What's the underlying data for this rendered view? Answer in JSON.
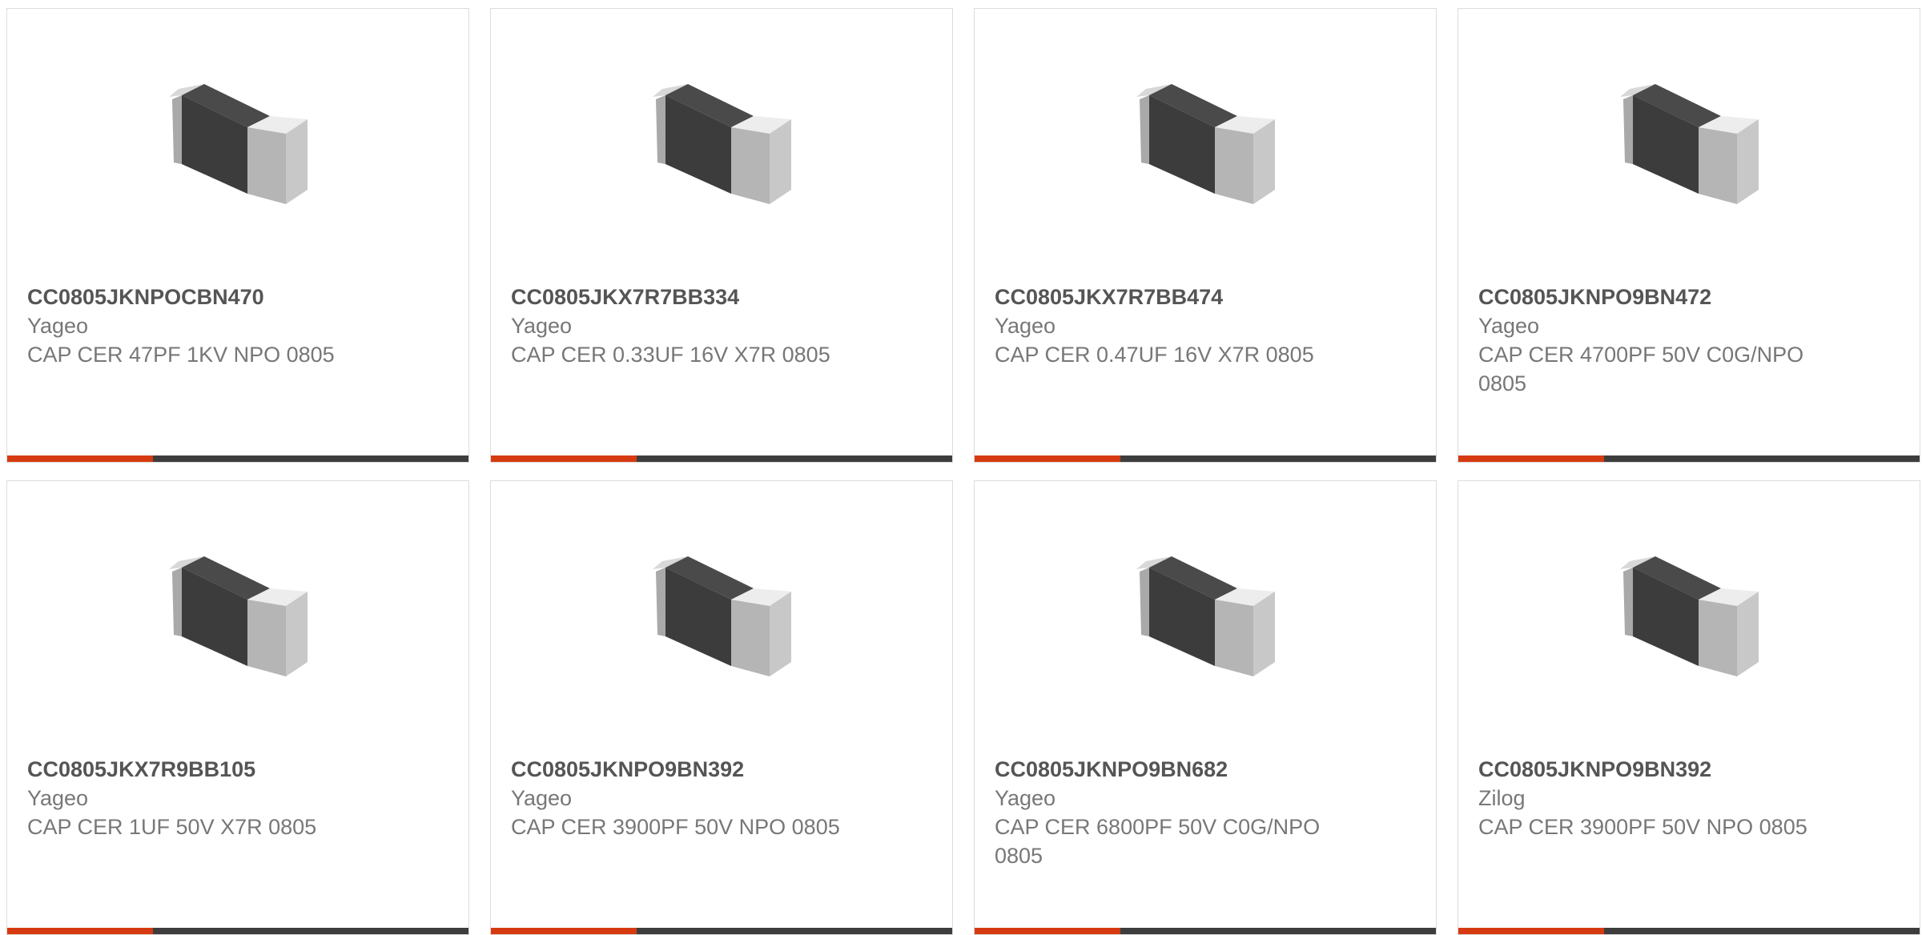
{
  "colors": {
    "accent": "#d63a11",
    "bar_dark": "#3d3d3d",
    "part_text": "#555555",
    "secondary_text": "#777777",
    "card_border": "#dcdcdc"
  },
  "products": [
    {
      "part_number": "CC0805JKNPOCBN470",
      "manufacturer": "Yageo",
      "description": "CAP CER 47PF 1KV NPO 0805",
      "image_icon": "smd-capacitor-image"
    },
    {
      "part_number": "CC0805JKX7R7BB334",
      "manufacturer": "Yageo",
      "description": "CAP CER 0.33UF 16V X7R 0805",
      "image_icon": "smd-capacitor-image"
    },
    {
      "part_number": "CC0805JKX7R7BB474",
      "manufacturer": "Yageo",
      "description": "CAP CER 0.47UF 16V X7R 0805",
      "image_icon": "smd-capacitor-image"
    },
    {
      "part_number": "CC0805JKNPO9BN472",
      "manufacturer": "Yageo",
      "description": "CAP CER 4700PF 50V C0G/NPO 0805",
      "image_icon": "smd-capacitor-image"
    },
    {
      "part_number": "CC0805JKX7R9BB105",
      "manufacturer": "Yageo",
      "description": "CAP CER 1UF 50V X7R 0805",
      "image_icon": "smd-capacitor-image"
    },
    {
      "part_number": "CC0805JKNPO9BN392",
      "manufacturer": "Yageo",
      "description": "CAP CER 3900PF 50V NPO 0805",
      "image_icon": "smd-capacitor-image"
    },
    {
      "part_number": "CC0805JKNPO9BN682",
      "manufacturer": "Yageo",
      "description": "CAP CER 6800PF 50V C0G/NPO 0805",
      "image_icon": "smd-capacitor-image"
    },
    {
      "part_number": "CC0805JKNPO9BN392",
      "manufacturer": "Zilog",
      "description": "CAP CER 3900PF 50V NPO 0805",
      "image_icon": "smd-capacitor-image"
    }
  ]
}
